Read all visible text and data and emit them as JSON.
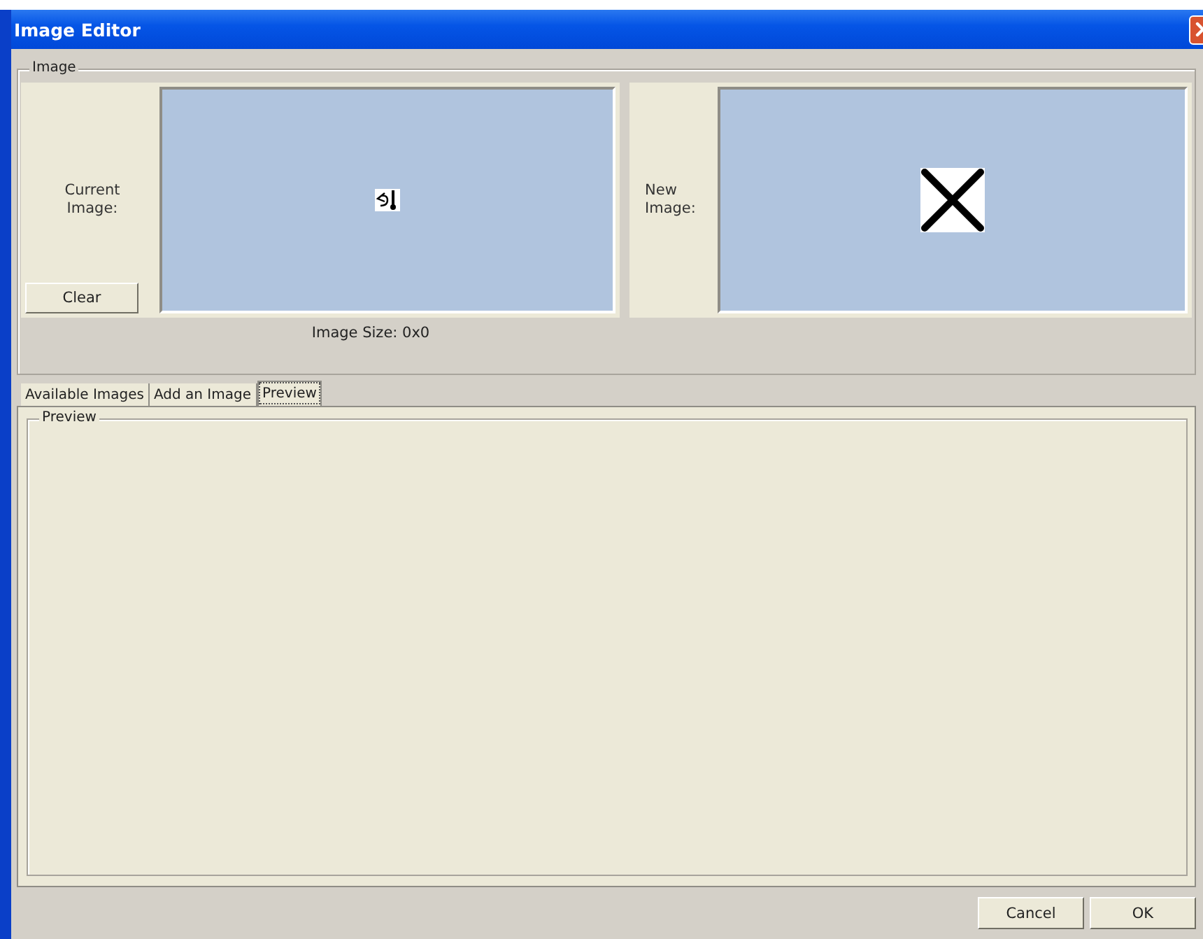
{
  "window": {
    "title": "Image Editor"
  },
  "image_group": {
    "title": "Image",
    "current_label": "Current Image:",
    "clear_button": "Clear",
    "new_label": "New Image:",
    "size_text": "Image Size: 0x0"
  },
  "tabs": [
    {
      "label": "Available Images",
      "selected": false
    },
    {
      "label": "Add an Image",
      "selected": false
    },
    {
      "label": "Preview",
      "selected": true
    }
  ],
  "preview_group": {
    "title": "Preview"
  },
  "buttons": [
    "Cancel",
    "OK"
  ]
}
